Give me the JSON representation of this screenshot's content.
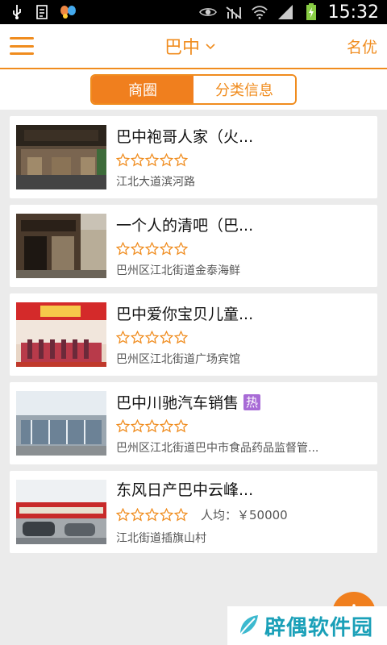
{
  "status_bar": {
    "time": "15:32",
    "icons": [
      "usb-icon",
      "file-icon",
      "butterfly-icon",
      "eye-icon",
      "no-signal-icon",
      "wifi-icon",
      "signal-icon",
      "battery-icon"
    ]
  },
  "header": {
    "city": "巴中",
    "right_label": "名优"
  },
  "tabs": [
    {
      "label": "商圈",
      "active": true
    },
    {
      "label": "分类信息",
      "active": false
    }
  ],
  "listings": [
    {
      "title": "巴中袍哥人家（火...",
      "address": "江北大道滨河路",
      "price": "",
      "hot": ""
    },
    {
      "title": "一个人的清吧（巴...",
      "address": "巴州区江北街道金泰海鲜",
      "price": "",
      "hot": ""
    },
    {
      "title": "巴中爱你宝贝儿童...",
      "address": "巴州区江北街道广场宾馆",
      "price": "",
      "hot": ""
    },
    {
      "title": "巴中川驰汽车销售",
      "address": "巴州区江北街道巴中市食品药品监督管...",
      "price": "",
      "hot": "热"
    },
    {
      "title": "东风日产巴中云峰...",
      "address": "江北街道插旗山村",
      "price": "人均：￥50000",
      "hot": ""
    }
  ],
  "watermark": "辟偶软件园",
  "colors": {
    "accent": "#f08c1e",
    "hot_badge": "#a86bd6",
    "watermark": "#1aa0b8"
  }
}
